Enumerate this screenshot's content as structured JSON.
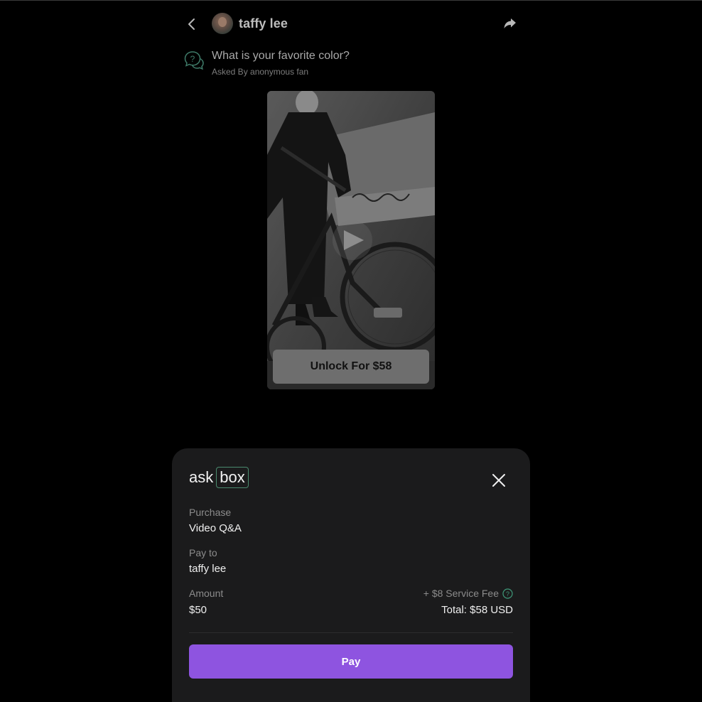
{
  "header": {
    "creator_name": "taffy lee",
    "back_icon": "chevron-left-icon",
    "share_icon": "share-arrow-icon"
  },
  "question": {
    "text": "What is your favorite color?",
    "asked_by": "Asked By anonymous fan",
    "icon": "question-bubble-icon"
  },
  "video": {
    "unlock_label": "Unlock For $58",
    "play_icon": "play-icon"
  },
  "checkout": {
    "brand_ask": "ask",
    "brand_box": "box",
    "purchase_label": "Purchase",
    "purchase_value": "Video Q&A",
    "pay_to_label": "Pay to",
    "pay_to_value": "taffy lee",
    "amount_label": "Amount",
    "amount_value": "$50",
    "service_fee": "+ $8 Service Fee",
    "total": "Total: $58 USD",
    "pay_label": "Pay",
    "close_icon": "close-icon",
    "help_icon": "help-circle-icon"
  },
  "colors": {
    "background": "#000000",
    "sheet": "#1b1b1c",
    "pay_button": "#8e54e0",
    "brand_accent": "#4a8a6e"
  }
}
